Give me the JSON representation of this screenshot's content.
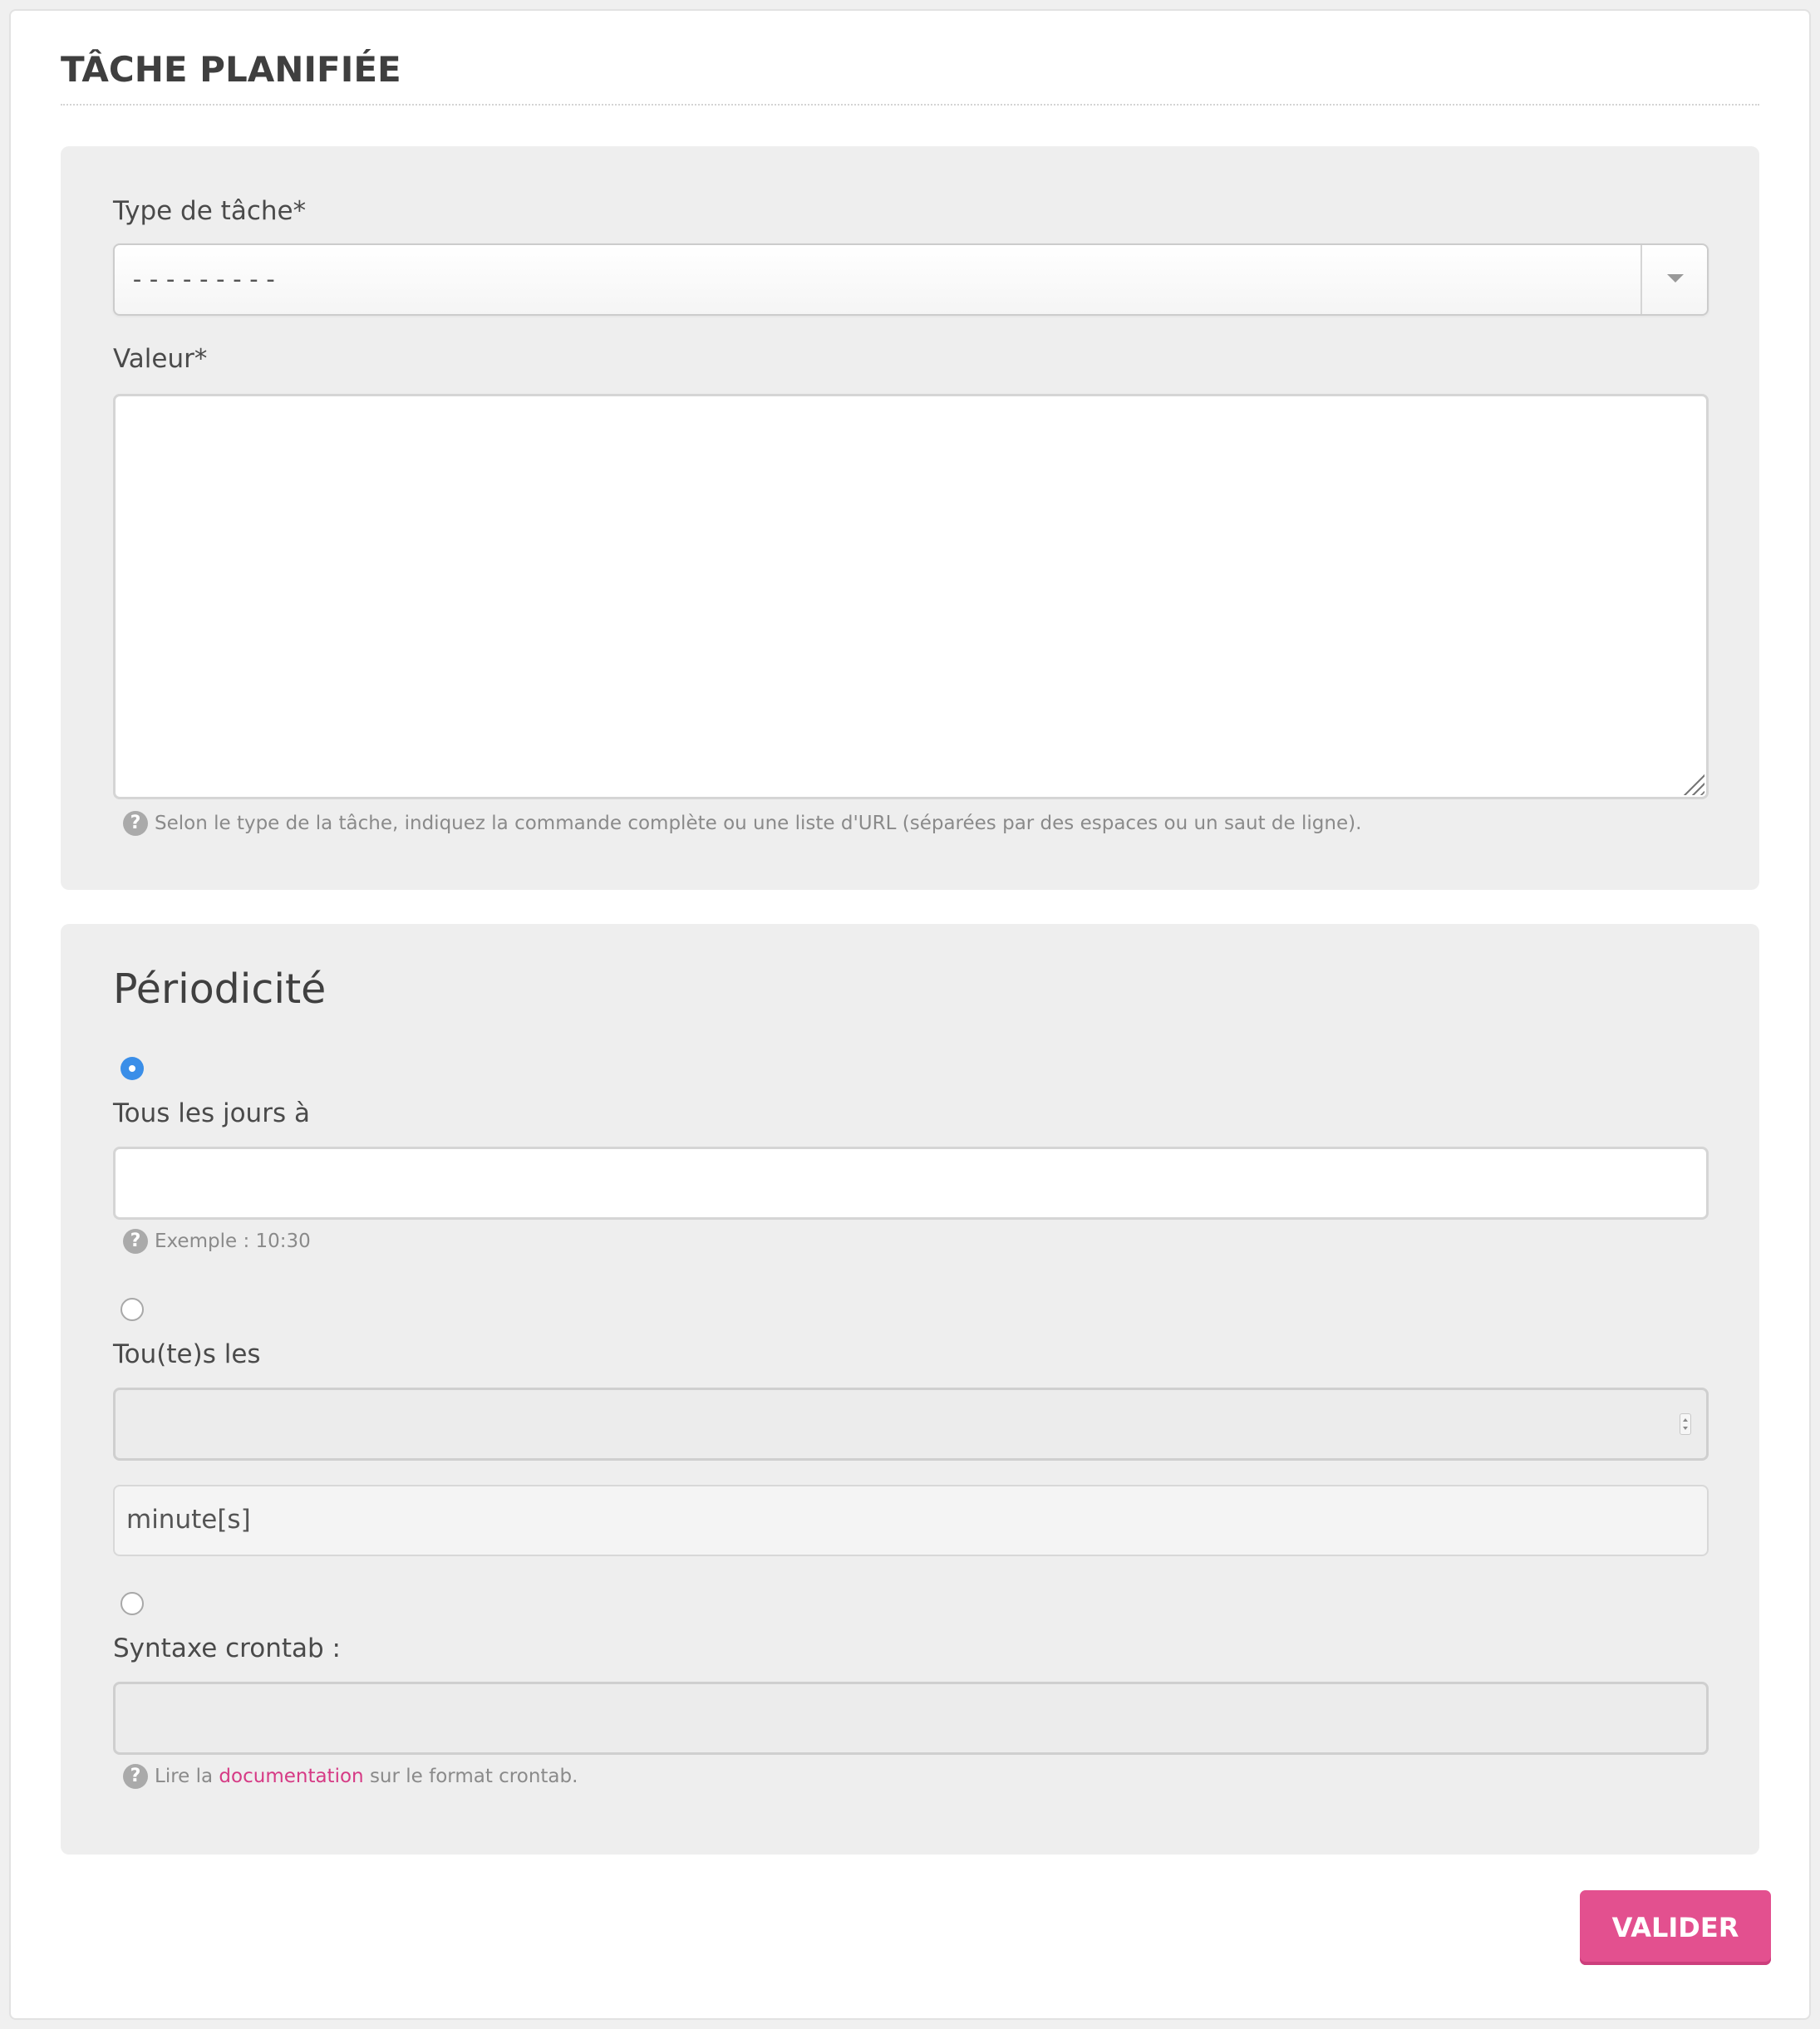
{
  "header": {
    "title": "TÂCHE PLANIFIÉE"
  },
  "task": {
    "type_label": "Type de tâche*",
    "type_value": "---------",
    "value_label": "Valeur*",
    "value_text": "",
    "value_help": "Selon le type de la tâche, indiquez la commande complète ou une liste d'URL (séparées par des espaces ou un saut de ligne)."
  },
  "periodicity": {
    "title": "Périodicité",
    "daily": {
      "selected": true,
      "label": "Tous les jours à",
      "value": "",
      "help": "Exemple : 10:30"
    },
    "interval": {
      "selected": false,
      "label": "Tou(te)s les",
      "value": "",
      "unit": "minute[s]"
    },
    "crontab": {
      "selected": false,
      "label": "Syntaxe crontab :",
      "value": "",
      "help_prefix": "Lire la",
      "help_link": "documentation",
      "help_suffix": "sur le format crontab."
    }
  },
  "actions": {
    "submit_label": "VALIDER"
  },
  "colors": {
    "accent": "#e3508f",
    "radio_checked": "#3a8ee8",
    "panel_bg": "#eeeeee"
  },
  "icons": {
    "help": "question-circle-icon",
    "dropdown": "caret-down-icon"
  }
}
